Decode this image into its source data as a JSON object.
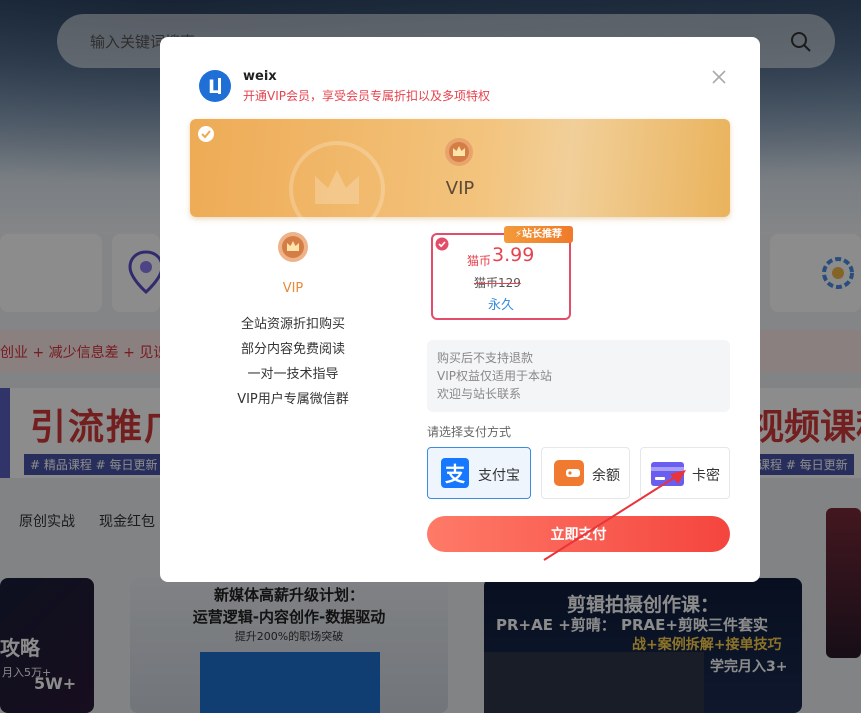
{
  "background": {
    "search_placeholder": "输入关键词搜索",
    "ticker": "创业 + 减少信息差 + 见识",
    "banner_left": {
      "title": "引流推广",
      "tag": "# 精品课程  # 每日更新"
    },
    "banner_right": {
      "title": "视频课程",
      "tag": "课程  # 每日更新"
    },
    "tabs": [
      "原创实战",
      "现金红包"
    ],
    "course_1": {
      "title": "攻略",
      "sub": "月入5万+",
      "num": "5W+"
    },
    "course_2": {
      "title": "新媒体高薪升级计划：",
      "title2": "运营逻辑-内容创作-数据驱动",
      "sub": "提升200%的职场突破"
    },
    "course_3": {
      "title": "剪辑拍摄创作课：",
      "line2": "PR+AE +剪晴：  PRAE+剪映三件套实",
      "line3": "战+案例拆解+接单技巧",
      "line4": "学完月入3+"
    }
  },
  "modal": {
    "site_name": "weix",
    "description": "开通VIP会员，享受会员专属折扣以及多项特权",
    "plan_card": {
      "label": "VIP"
    },
    "plan_detail": {
      "label": "VIP",
      "perks": [
        "全站资源折扣购买",
        "部分内容免费阅读",
        "一对一技术指导",
        "VIP用户专属微信群"
      ]
    },
    "price": {
      "badge": "站长推荐",
      "currency": "猫币",
      "value": "3.99",
      "original": "猫币129",
      "period": "永久"
    },
    "notice": [
      "购买后不支持退款",
      "VIP权益仅适用于本站",
      "欢迎与站长联系"
    ],
    "payment_label": "请选择支付方式",
    "payment_methods": [
      {
        "label": "支付宝",
        "selected": true
      },
      {
        "label": "余额",
        "selected": false
      },
      {
        "label": "卡密",
        "selected": false
      }
    ],
    "pay_button": "立即支付"
  },
  "colors": {
    "accent_red": "#e6434e",
    "gold": "#eeab55",
    "blue": "#3a8de0"
  }
}
